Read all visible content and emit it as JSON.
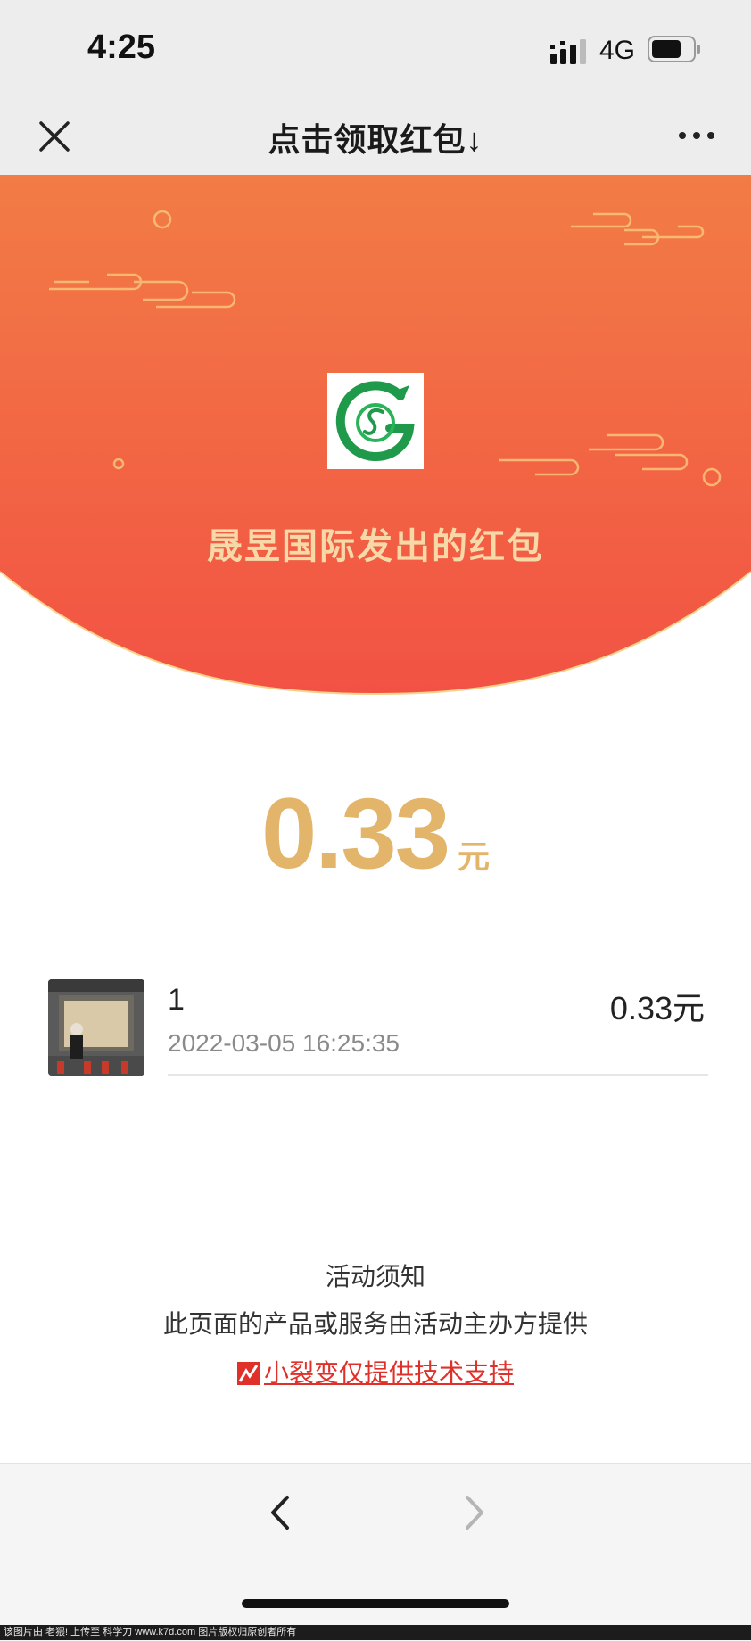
{
  "status_bar": {
    "time": "4:25",
    "network": "4G"
  },
  "nav": {
    "title": "点击领取红包↓"
  },
  "hero": {
    "sender": "晟昱国际发出的红包"
  },
  "amount": {
    "value": "0.33",
    "unit": "元"
  },
  "records": [
    {
      "name": "1",
      "time": "2022-03-05 16:25:35",
      "amount": "0.33元"
    }
  ],
  "footer": {
    "notice": "活动须知",
    "provider": "此页面的产品或服务由活动主办方提供",
    "support": "小裂变仅提供技术支持"
  },
  "watermark": "该图片由 老猥! 上传至 科学刀 www.k7d.com 图片版权归原创者所有",
  "colors": {
    "red_top": "#f27c45",
    "red_bottom": "#f25244",
    "gold": "#e3b56a",
    "link": "#e0302a"
  }
}
